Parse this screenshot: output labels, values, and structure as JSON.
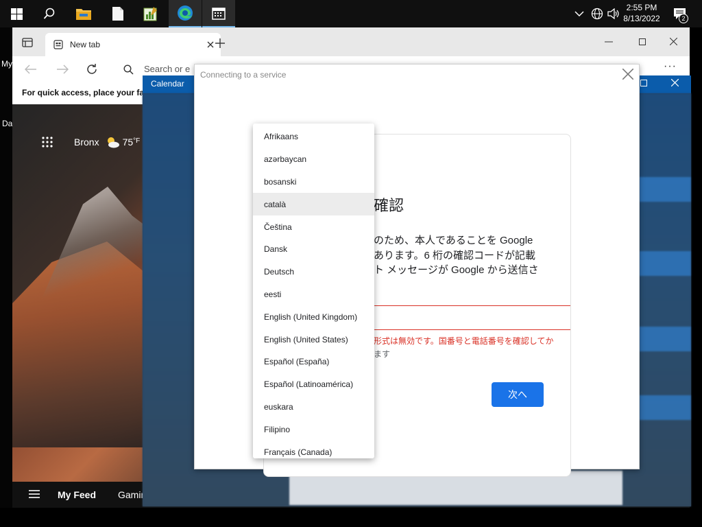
{
  "taskbar": {
    "apps": [
      {
        "name": "start",
        "icon": "windows-logo-icon"
      },
      {
        "name": "search",
        "icon": "search-icon"
      },
      {
        "name": "file-explorer",
        "icon": "folder-icon"
      },
      {
        "name": "notepad",
        "icon": "document-icon"
      },
      {
        "name": "spreadsheet",
        "icon": "chart-document-icon"
      },
      {
        "name": "edge",
        "icon": "edge-icon"
      },
      {
        "name": "calendar",
        "icon": "calendar-icon"
      }
    ],
    "time": "2:55 PM",
    "date": "8/13/2022",
    "notification_count": "2"
  },
  "desktop": {
    "label_my": "My",
    "label_da": "Da"
  },
  "browser": {
    "tab_title": "New tab",
    "search_placeholder": "Search or e",
    "favorites_hint": "For quick access, place your favo",
    "weather": {
      "location": "Bronx",
      "temp": "75",
      "unit": "°F"
    },
    "feed_tabs": [
      "My Feed",
      "Gamin"
    ]
  },
  "calendar": {
    "title": "Calendar"
  },
  "dialog": {
    "title": "Connecting to a service",
    "verify_title": "確認",
    "verify_desc_lines": [
      "のため、本人であることを Google",
      "あります。6 桁の確認コードが記載",
      "ト メッセージが Google から送信さ"
    ],
    "error_text": "形式は無効です。国番号と電話番号を確認してか",
    "error_tail": "ます",
    "next_label": "次へ"
  },
  "language_menu": {
    "selected": "català",
    "items": [
      "Afrikaans",
      "azərbaycan",
      "bosanski",
      "català",
      "Čeština",
      "Dansk",
      "Deutsch",
      "eesti",
      "English (United Kingdom)",
      "English (United States)",
      "Español (España)",
      "Español (Latinoamérica)",
      "euskara",
      "Filipino",
      "Français (Canada)"
    ]
  },
  "colors": {
    "taskbar": "#101010",
    "calendar_titlebar": "#0b5cab",
    "google_blue": "#1a73e8",
    "error_red": "#d93025"
  }
}
